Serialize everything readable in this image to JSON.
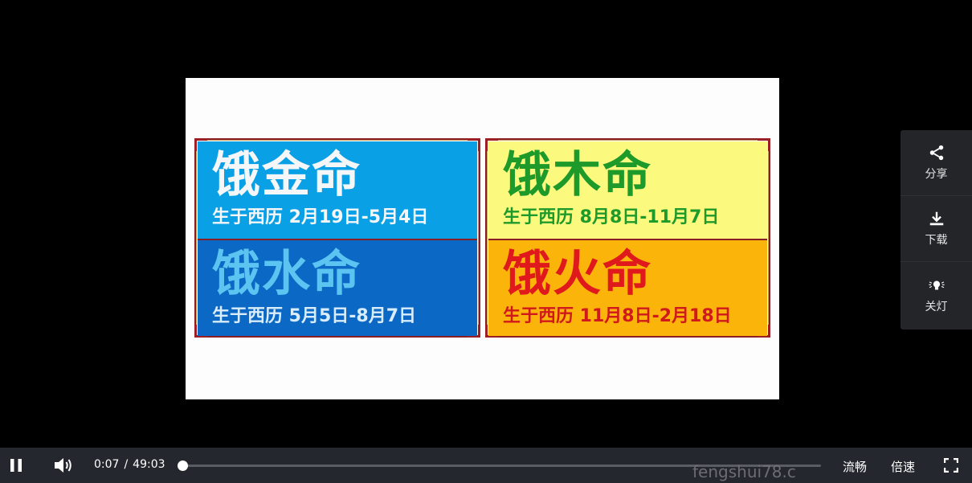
{
  "video": {
    "panels": [
      {
        "name": "饿金命",
        "dates": "生于西历 2月19日-5月4日"
      },
      {
        "name": "饿木命",
        "dates": "生于西历 8月8日-11月7日"
      },
      {
        "name": "饿水命",
        "dates": "生于西历 5月5日-8月7日"
      },
      {
        "name": "饿火命",
        "dates": "生于西历 11月8日-2月18日"
      }
    ]
  },
  "side_menu": {
    "share_label": "分享",
    "download_label": "下载",
    "lights_label": "关灯"
  },
  "controls": {
    "current_time": "0:07",
    "separator": "/",
    "duration": "49:03",
    "progress_fraction": 0.0024,
    "quality_label": "流畅",
    "speed_label": "倍速",
    "watermark": "fengshui78.c"
  },
  "colors": {
    "gold_bg": "#0aa0e6",
    "water_bg": "#0b68c4",
    "wood_bg": "#fcfa7e",
    "fire_bg": "#fbb409",
    "frame_border": "#8b1e24"
  }
}
